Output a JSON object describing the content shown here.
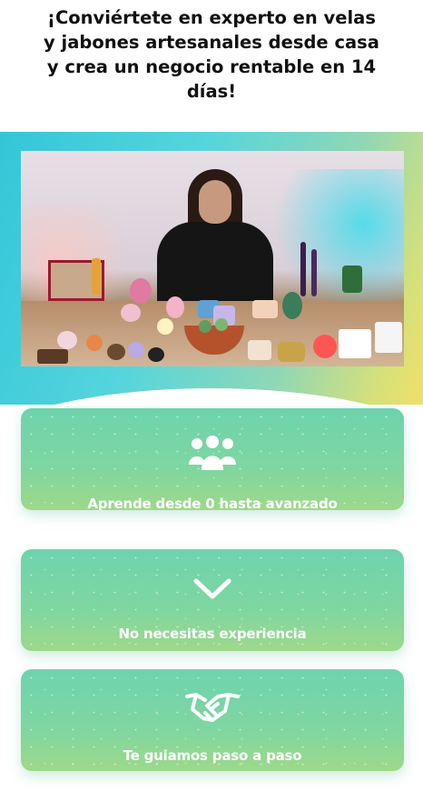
{
  "headline": {
    "line1": "¡Conviértete en experto en velas",
    "line2": "y jabones artesanales desde casa",
    "line3": "y crea un negocio rentable en 14",
    "line4": "días!"
  },
  "hero": {
    "video_thumbnail": "presenter-with-handmade-candles-and-soaps"
  },
  "features": [
    {
      "icon": "group-of-people-icon",
      "label": "Aprende desde 0 hasta avanzado"
    },
    {
      "icon": "chevron-down-icon",
      "label": "No necesitas experiencia"
    },
    {
      "icon": "handshake-icon",
      "label": "Te guiamos paso a paso"
    }
  ],
  "colors": {
    "card_gradient_top": "#6dd3ae",
    "card_gradient_bottom": "#9ed98a",
    "hero_teal": "#33c6d8",
    "hero_yellow": "#f2df6a"
  }
}
